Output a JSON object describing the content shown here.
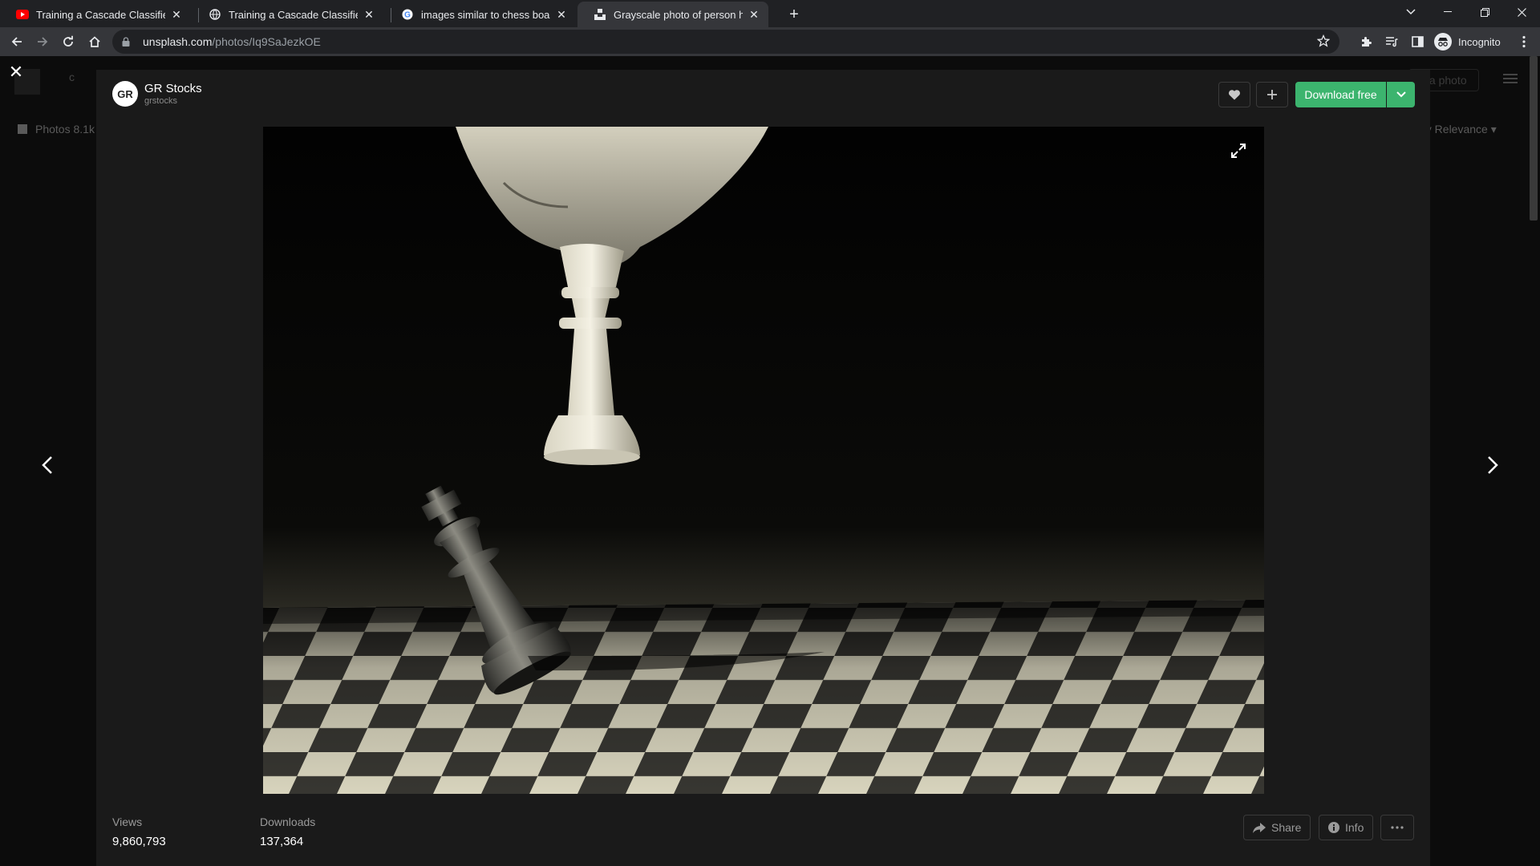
{
  "browser": {
    "tabs": [
      {
        "title": "Training a Cascade Classifier - Op",
        "favicon": "youtube-icon"
      },
      {
        "title": "Training a Cascade Classifier - Le",
        "favicon": "globe-icon"
      },
      {
        "title": "images similar to chess board - G",
        "favicon": "google-icon"
      },
      {
        "title": "Grayscale photo of person holdin",
        "favicon": "unsplash-icon"
      }
    ],
    "url_host": "unsplash.com",
    "url_path": "/photos/Iq9SaJezkOE",
    "profile_label": "Incognito"
  },
  "background": {
    "search_placeholder": "c",
    "submit_label": "it a photo",
    "photos_tab": "Photos 8.1k",
    "sort_label": "by Relevance"
  },
  "photo_modal": {
    "author": {
      "name": "GR Stocks",
      "handle": "grstocks",
      "avatar_text": "GR"
    },
    "download_label": "Download free",
    "stats": {
      "views_label": "Views",
      "views_value": "9,860,793",
      "downloads_label": "Downloads",
      "downloads_value": "137,364"
    },
    "share_label": "Share",
    "info_label": "Info",
    "accent_color": "#3cb46e"
  }
}
